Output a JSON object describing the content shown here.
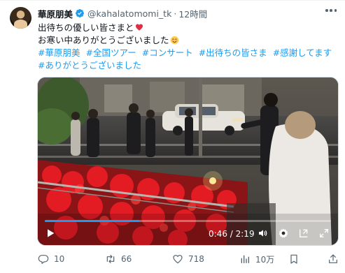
{
  "tweet": {
    "author_name": "華原朋美",
    "handle": "@kahalatomomi_tk",
    "separator": "·",
    "time": "12時間",
    "text_line1": "出待ちの優しい皆さまと",
    "text_line2": "お寒い中ありがとうございました",
    "hashtags": [
      "#華原朋美",
      "#全国ツアー",
      "#コンサート",
      "#出待ちの皆さま",
      "#感謝してます",
      "#ありがとうございました"
    ]
  },
  "video": {
    "current_time": "0:46",
    "duration": "2:19",
    "time_separator": " / ",
    "progress": 0.33
  },
  "actions": {
    "replies": "10",
    "retweets": "66",
    "likes": "718",
    "views": "10万"
  },
  "colors": {
    "accent": "#1d9bf0",
    "muted": "#536471",
    "verified": "#1d9bf0"
  }
}
